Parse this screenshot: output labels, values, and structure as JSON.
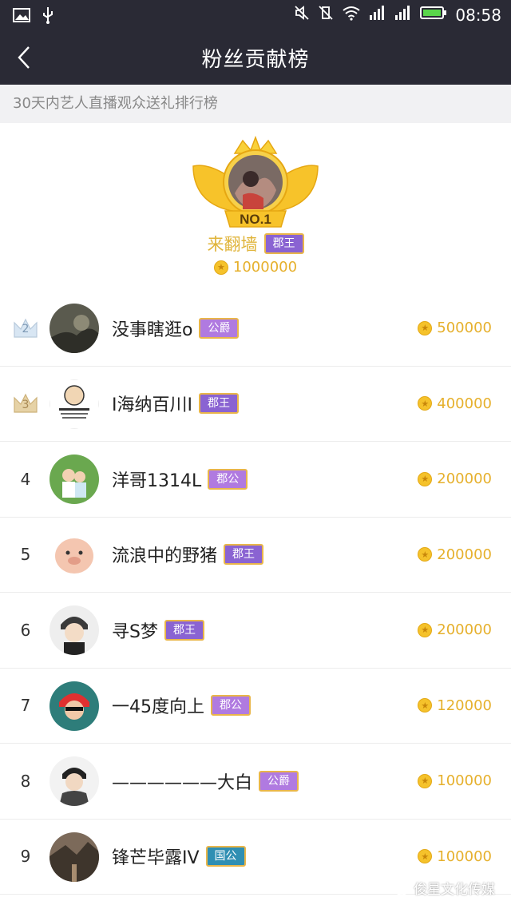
{
  "status_bar": {
    "time": "08:58"
  },
  "header": {
    "title": "粉丝贡献榜"
  },
  "subtitle": "30天内艺人直播观众送礼排行榜",
  "champion": {
    "badge_text": "NO.1",
    "name": "来翻墙",
    "rank_title": "郡王",
    "score": "1000000"
  },
  "list": [
    {
      "rank": "2",
      "name": "没事瞎逛o",
      "title": "公爵",
      "score": "500000"
    },
    {
      "rank": "3",
      "name": "I海纳百川I",
      "title": "郡王",
      "score": "400000"
    },
    {
      "rank": "4",
      "name": "洋哥1314L",
      "title": "郡公",
      "score": "200000"
    },
    {
      "rank": "5",
      "name": "流浪中的野猪",
      "title": "郡王",
      "score": "200000"
    },
    {
      "rank": "6",
      "name": "寻S梦",
      "title": "郡王",
      "score": "200000"
    },
    {
      "rank": "7",
      "name": "一45度向上",
      "title": "郡公",
      "score": "120000"
    },
    {
      "rank": "8",
      "name": "——————大白",
      "title": "公爵",
      "score": "100000"
    },
    {
      "rank": "9",
      "name": "锋芒毕露IV",
      "title": "国公",
      "score": "100000"
    }
  ],
  "watermark": "俊星文化传媒",
  "colors": {
    "header_bg": "#2a2a35",
    "gold": "#e6b02c",
    "badge_purple": "#8a63d2",
    "badge_teal": "#2f8fb3",
    "badge_gold_border": "#e9b64a"
  }
}
